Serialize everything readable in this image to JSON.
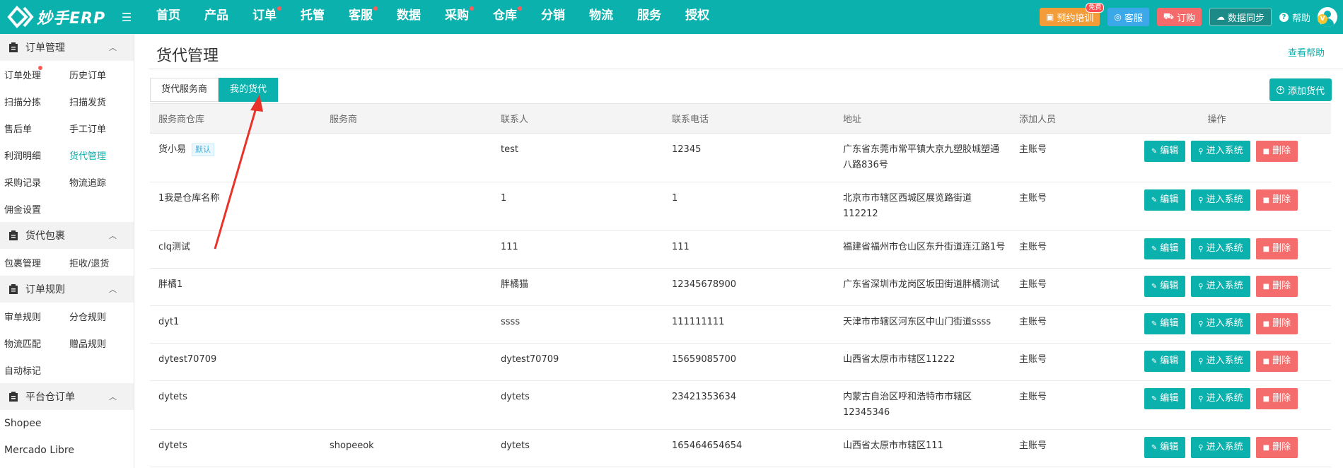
{
  "header": {
    "logo_text": "妙手ERP",
    "nav": [
      {
        "label": "首页",
        "dot": false
      },
      {
        "label": "产品",
        "dot": false
      },
      {
        "label": "订单",
        "dot": true
      },
      {
        "label": "托管",
        "dot": false
      },
      {
        "label": "客服",
        "dot": true
      },
      {
        "label": "数据",
        "dot": false
      },
      {
        "label": "采购",
        "dot": true
      },
      {
        "label": "仓库",
        "dot": true
      },
      {
        "label": "分销",
        "dot": false
      },
      {
        "label": "物流",
        "dot": false
      },
      {
        "label": "服务",
        "dot": false
      },
      {
        "label": "授权",
        "dot": false
      }
    ],
    "train_label": "预约培训",
    "free_badge": "免费",
    "service_label": "客服",
    "order_label": "订购",
    "sync_label": "数据同步",
    "help_label": "帮助",
    "avatar_level": "V"
  },
  "sidebar": {
    "sections": [
      {
        "title": "订单管理",
        "links": [
          [
            "订单处理",
            "历史订单"
          ],
          [
            "扫描分拣",
            "扫描发货"
          ],
          [
            "售后单",
            "手工订单"
          ],
          [
            "利润明细",
            "货代管理"
          ],
          [
            "采购记录",
            "物流追踪"
          ],
          [
            "佣金设置"
          ]
        ]
      },
      {
        "title": "货代包裹",
        "links": [
          [
            "包裹管理",
            "拒收/退货"
          ]
        ]
      },
      {
        "title": "订单规则",
        "links": [
          [
            "审单规则",
            "分仓规则"
          ],
          [
            "物流匹配",
            "赠品规则"
          ],
          [
            "自动标记"
          ]
        ]
      },
      {
        "title": "平台仓订单",
        "links": [
          [
            "Shopee"
          ],
          [
            "Mercado Libre"
          ]
        ]
      }
    ],
    "active": "货代管理",
    "dot_on": "订单处理"
  },
  "main": {
    "title": "货代管理",
    "help_link": "查看帮助",
    "tabs": [
      "货代服务商",
      "我的货代"
    ],
    "active_tab": 1,
    "add_button": "添加货代",
    "columns": [
      "服务商仓库",
      "服务商",
      "联系人",
      "联系电话",
      "地址",
      "添加人员",
      "操作"
    ],
    "default_tag": "默认",
    "actions": {
      "edit": "编辑",
      "enter": "进入系统",
      "delete": "删除"
    },
    "rows": [
      {
        "warehouse": "货小易",
        "default": true,
        "provider": "",
        "contact": "test",
        "phone": "12345",
        "address": "广东省东莞市常平镇大京九塑胶城塑通八路836号",
        "added_by": "主账号"
      },
      {
        "warehouse": "1我是仓库名称",
        "default": false,
        "provider": "",
        "contact": "1",
        "phone": "1",
        "address": "北京市市辖区西城区展览路街道112212",
        "added_by": "主账号"
      },
      {
        "warehouse": "clq测试",
        "default": false,
        "provider": "",
        "contact": "111",
        "phone": "111",
        "address": "福建省福州市仓山区东升街道连江路1号",
        "added_by": "主账号"
      },
      {
        "warehouse": "胖橘1",
        "default": false,
        "provider": "",
        "contact": "胖橘猫",
        "phone": "12345678900",
        "address": "广东省深圳市龙岗区坂田街道胖橘测试",
        "added_by": "主账号"
      },
      {
        "warehouse": "dyt1",
        "default": false,
        "provider": "",
        "contact": "ssss",
        "phone": "111111111",
        "address": "天津市市辖区河东区中山门街道ssss",
        "added_by": "主账号"
      },
      {
        "warehouse": "dytest70709",
        "default": false,
        "provider": "",
        "contact": "dytest70709",
        "phone": "15659085700",
        "address": "山西省太原市市辖区11222",
        "added_by": "主账号"
      },
      {
        "warehouse": "dytets",
        "default": false,
        "provider": "",
        "contact": "dytets",
        "phone": "23421353634",
        "address": "内蒙古自治区呼和浩特市市辖区12345346",
        "added_by": "主账号"
      },
      {
        "warehouse": "dytets",
        "default": false,
        "provider": "shopeeok",
        "contact": "dytets",
        "phone": "165464654654",
        "address": "山西省太原市市辖区111",
        "added_by": "主账号"
      }
    ]
  },
  "colors": {
    "accent": "#0ab1ad",
    "danger": "#f56c6c",
    "annotation": "#e8322a"
  }
}
